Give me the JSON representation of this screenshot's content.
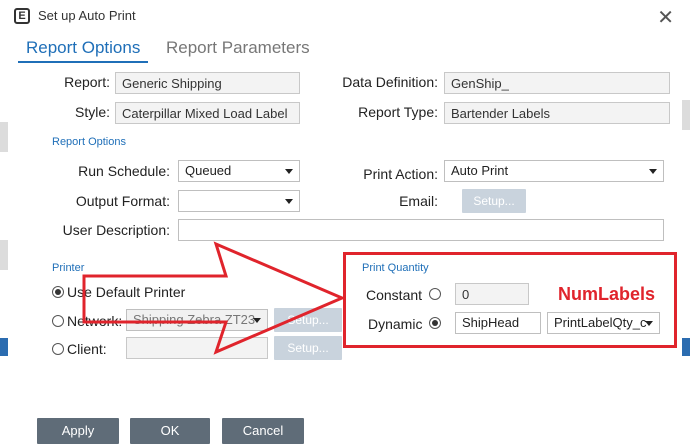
{
  "dialog": {
    "title": "Set up Auto Print",
    "app_icon_letter": "E",
    "close_glyph": "✕"
  },
  "tabs": [
    {
      "label": "Report Options"
    },
    {
      "label": "Report Parameters"
    }
  ],
  "report": {
    "report_label": "Report:",
    "report_value": "Generic Shipping",
    "style_label": "Style:",
    "style_value": "Caterpillar Mixed Load Label",
    "data_definition_label": "Data Definition:",
    "data_definition_value": "GenShip_",
    "report_type_label": "Report Type:",
    "report_type_value": "Bartender Labels"
  },
  "report_options": {
    "section_title": "Report Options",
    "run_schedule_label": "Run Schedule:",
    "run_schedule_value": "Queued",
    "output_format_label": "Output Format:",
    "output_format_value": "",
    "user_description_label": "User Description:",
    "user_description_value": "",
    "print_action_label": "Print Action:",
    "print_action_value": "Auto Print",
    "email_label": "Email:",
    "email_setup_button": "Setup..."
  },
  "printer": {
    "section_title": "Printer",
    "use_default_label": "Use Default Printer",
    "network_label": "Network:",
    "network_value": "Shipping Zebra ZT23",
    "network_setup_button": "Setup...",
    "client_label": "Client:",
    "client_value": "",
    "client_setup_button": "Setup..."
  },
  "print_quantity": {
    "section_title": "Print Quantity",
    "constant_label": "Constant",
    "constant_value": "0",
    "dynamic_label": "Dynamic",
    "dynamic_table_value": "ShipHead",
    "dynamic_field_value": "PrintLabelQty_c"
  },
  "annotation": {
    "label": "NumLabels",
    "color": "#e0242c"
  },
  "footer": {
    "apply_button": "Apply",
    "ok_button": "OK",
    "cancel_button": "Cancel"
  },
  "colors": {
    "accent": "#1f6fb8",
    "button_dark": "#5f6c78",
    "button_disabled": "#c9d3dd"
  }
}
